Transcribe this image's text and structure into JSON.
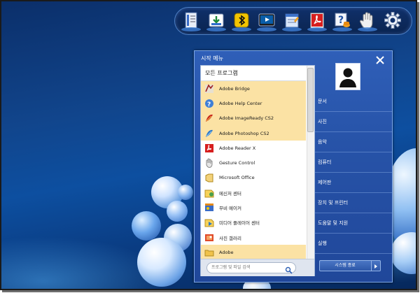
{
  "start_menu": {
    "title": "시작 메뉴",
    "all_programs_label": "모든 프로그램",
    "programs": [
      {
        "label": "Adobe Bridge",
        "icon": "adobe-bridge-icon",
        "highlighted": true
      },
      {
        "label": "Adobe Help Center",
        "icon": "adobe-help-center-icon",
        "highlighted": true
      },
      {
        "label": "Adobe ImageReady CS2",
        "icon": "adobe-imageready-icon",
        "highlighted": true
      },
      {
        "label": "Adobe Photoshop CS2",
        "icon": "adobe-photoshop-icon",
        "highlighted": true
      },
      {
        "label": "Adobe Reader X",
        "icon": "adobe-reader-icon",
        "highlighted": false
      },
      {
        "label": "Gesture Control",
        "icon": "gesture-control-icon",
        "highlighted": false
      },
      {
        "label": "Microsoft Office",
        "icon": "microsoft-office-icon",
        "highlighted": false
      },
      {
        "label": "메신저 센터",
        "icon": "messenger-center-icon",
        "highlighted": false
      },
      {
        "label": "무비 메이커",
        "icon": "movie-maker-icon",
        "highlighted": false
      },
      {
        "label": "미디어 플레이어 센터",
        "icon": "media-player-center-icon",
        "highlighted": false
      },
      {
        "label": "사진 갤러리",
        "icon": "photo-gallery-icon",
        "highlighted": false
      },
      {
        "label": "Adobe",
        "icon": "folder-icon",
        "highlighted": true
      }
    ],
    "search_placeholder": "프로그램 및 파일 검색",
    "right_items": [
      "문서",
      "사진",
      "음악",
      "컴퓨터",
      "제어판",
      "장치 및 프린터",
      "도움말 및 지원",
      "실행"
    ],
    "shutdown_label": "시스템 종료"
  },
  "dock": {
    "icons": [
      "document-icon",
      "downloads-icon",
      "bluetooth-icon",
      "media-player-icon",
      "notepad-icon",
      "adobe-reader-icon",
      "help-icon",
      "gesture-hand-icon",
      "settings-gear-icon"
    ]
  },
  "colors": {
    "menu_bg": "#2753a8",
    "highlight": "#fbe2a4",
    "desktop_dark": "#0b2f6a"
  }
}
